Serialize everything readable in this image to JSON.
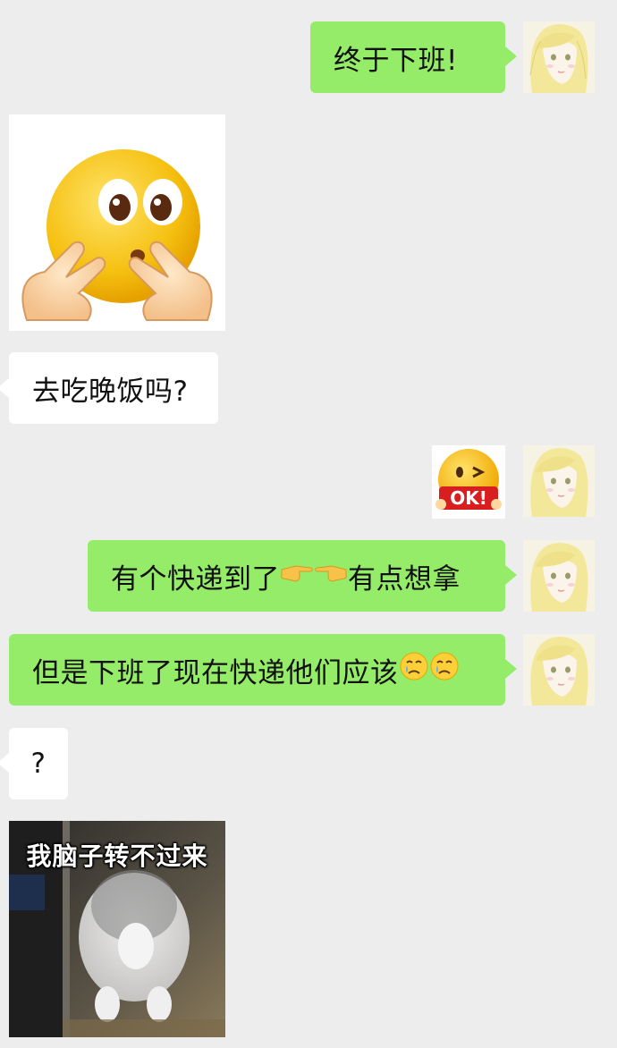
{
  "chat": {
    "messages": [
      {
        "side": "right",
        "type": "text",
        "text": "终于下班!"
      },
      {
        "side": "left",
        "type": "sticker",
        "sticker": "peeking-emoji-victory-hands"
      },
      {
        "side": "left",
        "type": "text",
        "text": "去吃晚饭吗?"
      },
      {
        "side": "right",
        "type": "sticker",
        "sticker": "winking-ok-emoji"
      },
      {
        "side": "right",
        "type": "text",
        "text_before": "有个快递到了",
        "emoji": [
          "pointing-right-icon",
          "pointing-left-icon"
        ],
        "text_after": "有点想拿"
      },
      {
        "side": "right",
        "type": "text",
        "text": "但是下班了现在快递他们应该",
        "emoji": [
          "crying-face-icon",
          "crying-face-icon"
        ]
      },
      {
        "side": "left",
        "type": "text",
        "text": "?"
      },
      {
        "side": "left",
        "type": "sticker",
        "sticker": "cat-meme",
        "caption": "我脑子转不过来"
      }
    ]
  },
  "colors": {
    "background": "#ededed",
    "my_bubble": "#95ec69",
    "their_bubble": "#ffffff",
    "text": "#111111"
  }
}
